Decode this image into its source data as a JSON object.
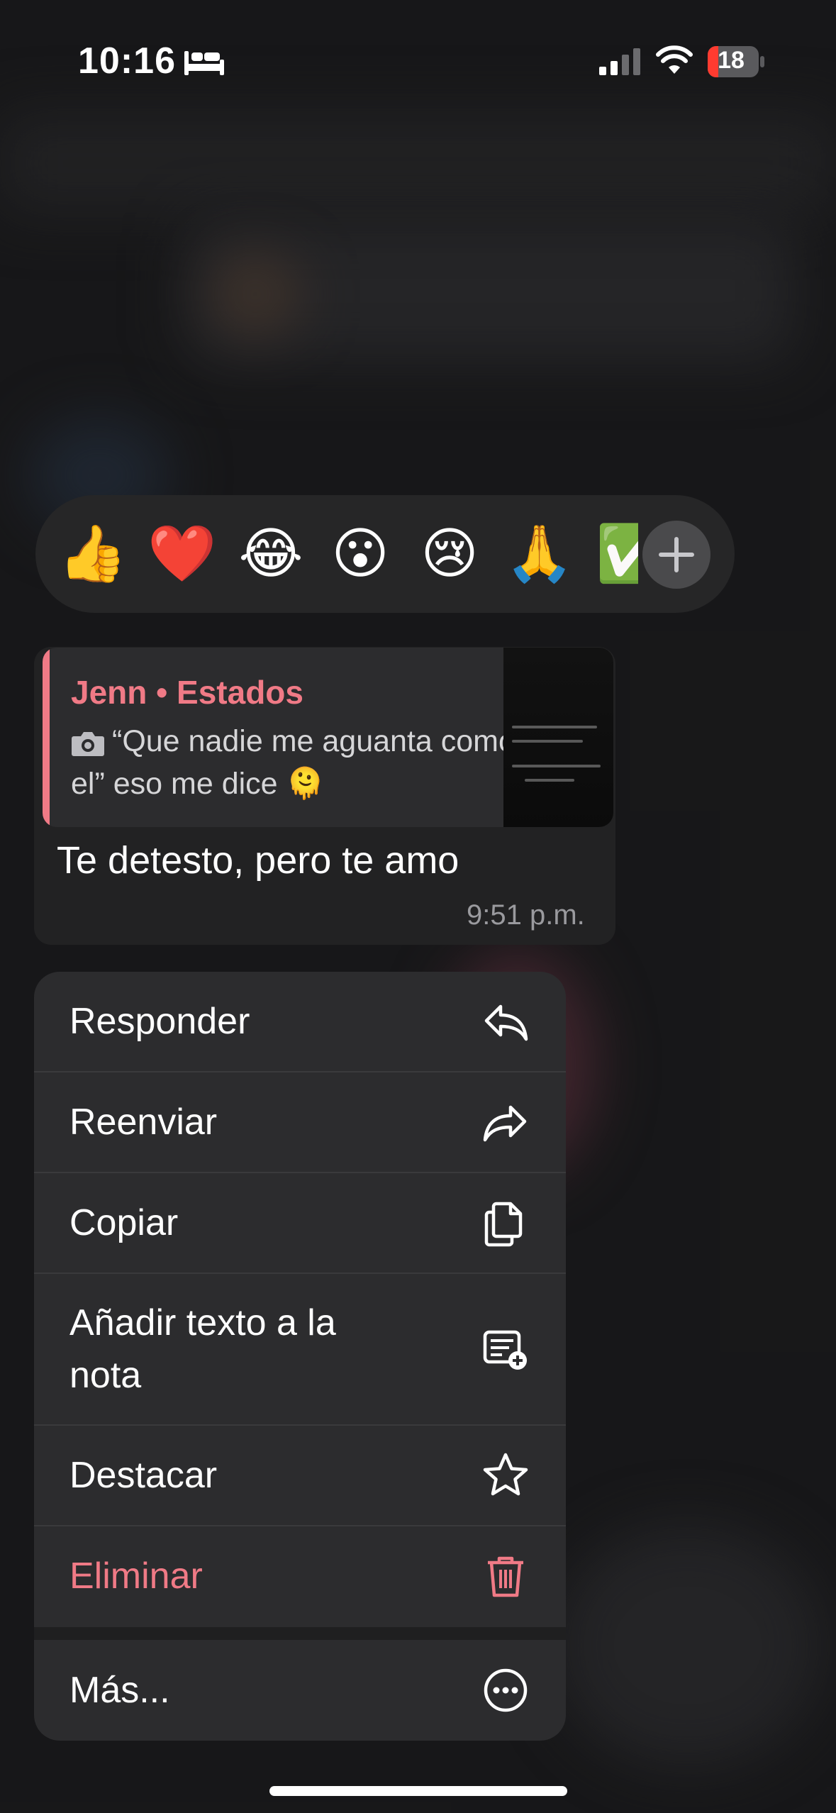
{
  "status_bar": {
    "time": "10:16",
    "battery": "18",
    "bed_icon": "bed-icon",
    "signal_icon": "signal-icon",
    "wifi_icon": "wifi-icon"
  },
  "reactions": {
    "emojis": [
      "👍",
      "❤️",
      "😂",
      "😮",
      "😢",
      "🙏",
      "✅"
    ],
    "more_icon": "plus-icon"
  },
  "message": {
    "quote_author": "Jenn • Estados",
    "quote_icon": "camera-icon",
    "quote_text": "“Que nadie me aguanta como el” eso me dice 🫠",
    "text": "Te detesto, pero te amo",
    "time": "9:51 p.m."
  },
  "menu": {
    "items": [
      {
        "label": "Responder",
        "icon": "reply-icon"
      },
      {
        "label": "Reenviar",
        "icon": "forward-icon"
      },
      {
        "label": "Copiar",
        "icon": "copy-icon"
      },
      {
        "label": "Añadir texto a la nota",
        "icon": "note-add-icon"
      },
      {
        "label": "Destacar",
        "icon": "star-icon"
      },
      {
        "label": "Eliminar",
        "icon": "trash-icon",
        "color": "#f07a86"
      },
      {
        "label": "Más...",
        "icon": "more-icon"
      }
    ]
  },
  "colors": {
    "accent_red": "#f07a86",
    "menu_bg": "#2c2c2e"
  }
}
